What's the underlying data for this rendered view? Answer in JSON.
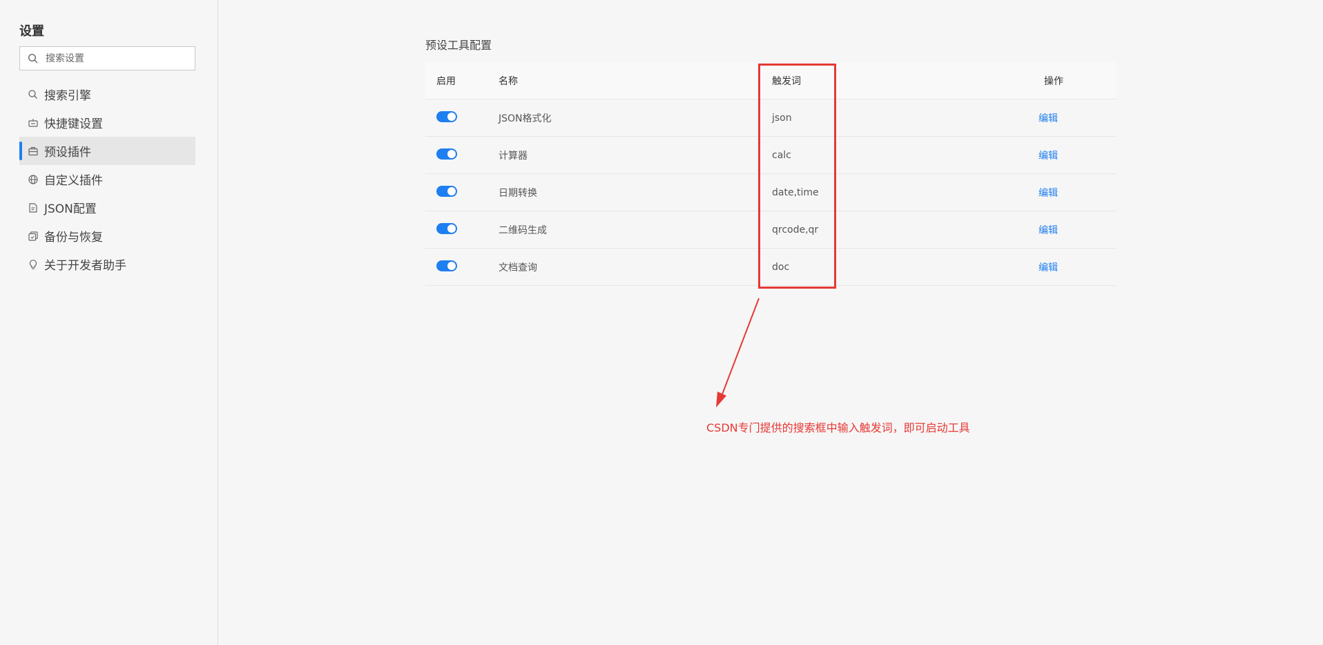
{
  "sidebar": {
    "title": "设置",
    "search_placeholder": "搜索设置",
    "items": [
      {
        "label": "搜索引擎",
        "icon": "search-icon"
      },
      {
        "label": "快捷键设置",
        "icon": "keyboard-icon"
      },
      {
        "label": "预设插件",
        "icon": "briefcase-icon",
        "active": true
      },
      {
        "label": "自定义插件",
        "icon": "globe-icon"
      },
      {
        "label": "JSON配置",
        "icon": "document-icon"
      },
      {
        "label": "备份与恢复",
        "icon": "backup-icon"
      },
      {
        "label": "关于开发者助手",
        "icon": "lightbulb-icon"
      }
    ]
  },
  "main": {
    "section_title": "预设工具配置",
    "table": {
      "headers": {
        "enable": "启用",
        "name": "名称",
        "trigger": "触发词",
        "action": "操作"
      },
      "rows": [
        {
          "name": "JSON格式化",
          "trigger": "json",
          "action": "编辑",
          "enabled": true
        },
        {
          "name": "计算器",
          "trigger": "calc",
          "action": "编辑",
          "enabled": true
        },
        {
          "name": "日期转换",
          "trigger": "date,time",
          "action": "编辑",
          "enabled": true
        },
        {
          "name": "二维码生成",
          "trigger": "qrcode,qr",
          "action": "编辑",
          "enabled": true
        },
        {
          "name": "文档查询",
          "trigger": "doc",
          "action": "编辑",
          "enabled": true
        }
      ]
    }
  },
  "annotation": {
    "text": "CSDN专门提供的搜索框中输入触发词，即可启动工具",
    "color": "#e53935"
  },
  "colors": {
    "accent": "#1e7ff0",
    "annotation": "#e53935"
  }
}
